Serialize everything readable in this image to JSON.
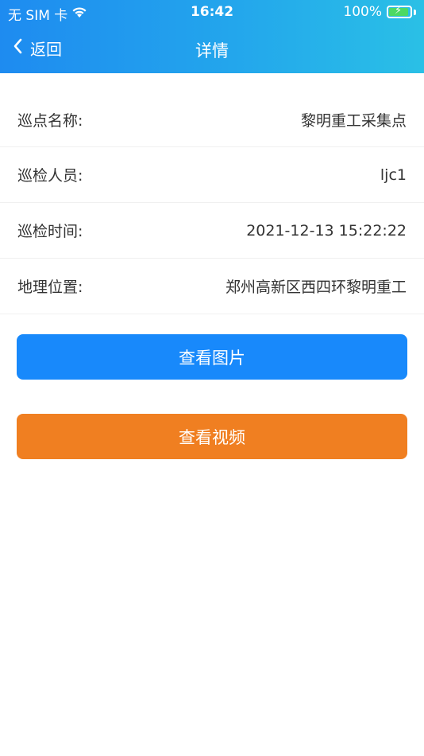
{
  "status_bar": {
    "carrier": "无 SIM 卡",
    "time": "16:42",
    "battery": "100%"
  },
  "nav": {
    "back_label": "返回",
    "title": "详情"
  },
  "details": [
    {
      "label": "巡点名称:",
      "value": "黎明重工采集点"
    },
    {
      "label": "巡检人员:",
      "value": "ljc1"
    },
    {
      "label": "巡检时间:",
      "value": "2021-12-13 15:22:22"
    },
    {
      "label": "地理位置:",
      "value": "郑州高新区西四环黎明重工"
    }
  ],
  "actions": {
    "view_images": "查看图片",
    "view_video": "查看视频"
  },
  "colors": {
    "header_gradient_start": "#1e8bf0",
    "header_gradient_end": "#2ac0e6",
    "primary_button": "#1889fb",
    "secondary_button": "#f07f21"
  },
  "icons": [
    "wifi-icon",
    "battery-icon",
    "charging-bolt-icon",
    "back-chevron-icon"
  ]
}
